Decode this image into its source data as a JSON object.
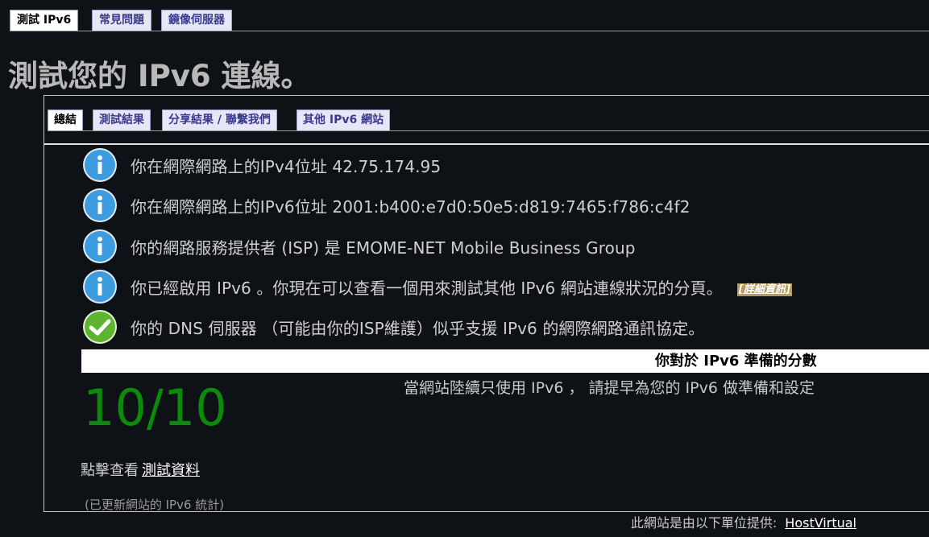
{
  "top_tabs": [
    {
      "label": "測試 IPv6",
      "active": true
    },
    {
      "label": "常見問題",
      "active": false
    },
    {
      "label": "鏡像伺服器",
      "active": false
    }
  ],
  "page_title": "測試您的 IPv6 連線。",
  "sub_tabs": [
    {
      "label": "總結",
      "active": true
    },
    {
      "label": "測試結果",
      "active": false
    },
    {
      "label": "分享結果 / 聯繫我們",
      "active": false
    },
    {
      "label": "其他 IPv6 網站",
      "active": false
    }
  ],
  "info_rows": [
    {
      "icon": "info-icon",
      "text": "你在網際網路上的IPv4位址 42.75.174.95"
    },
    {
      "icon": "info-icon",
      "text": "你在網際網路上的IPv6位址 2001:b400:e7d0:50e5:d819:7465:f786:c4f2"
    },
    {
      "icon": "info-icon",
      "text": "你的網路服務提供者 (ISP) 是 EMOME-NET Mobile Business Group"
    },
    {
      "icon": "info-icon",
      "text": "你已經啟用 IPv6 。你現在可以查看一個用來測試其他 IPv6 網站連線狀況的分頁。",
      "link": "[詳細資訊]"
    },
    {
      "icon": "check-icon",
      "text": "你的 DNS 伺服器 （可能由你的ISP維護）似乎支援 IPv6 的網際網路通訊協定。"
    }
  ],
  "score": {
    "title": "你對於 IPv6 準備的分數",
    "value": "10/10",
    "description": "當網站陸續只使用 IPv6 ， 請提早為您的 IPv6 做準備和設定"
  },
  "click_prefix": "點擊查看",
  "click_link": "測試資料",
  "updated_note": "(已更新網站的 IPv6 統計)",
  "footer": {
    "prefix": "此網站是由以下單位提供:",
    "link": "HostVirtual"
  },
  "colors": {
    "background": "#0e1116",
    "score_green": "#0b8a0b",
    "info_blue": "#3d9be0",
    "check_green": "#5db52f",
    "details_bg": "#b59a5a"
  }
}
